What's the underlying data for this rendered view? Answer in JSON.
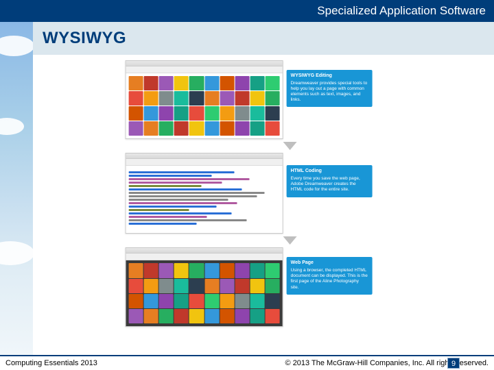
{
  "header": {
    "title": "Specialized Application Software"
  },
  "slide": {
    "title": "WYSIWYG"
  },
  "callouts": [
    {
      "title": "WYSIWYG Editing",
      "body": "Dreamweaver provides special tools to help you lay out a page with common elements such as text, images, and links."
    },
    {
      "title": "HTML Coding",
      "body": "Every time you save the web page, Adobe Dreamweaver creates the HTML code for the entire site."
    },
    {
      "title": "Web Page",
      "body": "Using a browser, the completed HTML document can be displayed. This is the first page of the Aline Photography site."
    }
  ],
  "thumbs": {
    "colors": [
      "#e67e22",
      "#c0392b",
      "#9b59b6",
      "#f1c40f",
      "#27ae60",
      "#3498db",
      "#d35400",
      "#8e44ad",
      "#16a085",
      "#2ecc71",
      "#e74c3c",
      "#f39c12",
      "#7f8c8d",
      "#1abc9c",
      "#2c3e50",
      "#e67e22",
      "#9b59b6",
      "#c0392b",
      "#f1c40f",
      "#27ae60",
      "#d35400",
      "#3498db",
      "#8e44ad",
      "#16a085",
      "#e74c3c",
      "#2ecc71",
      "#f39c12",
      "#7f8c8d",
      "#1abc9c",
      "#2c3e50",
      "#9b59b6",
      "#e67e22",
      "#27ae60",
      "#c0392b",
      "#f1c40f",
      "#3498db",
      "#d35400",
      "#8e44ad",
      "#16a085",
      "#e74c3c"
    ]
  },
  "footer": {
    "left": "Computing Essentials 2013",
    "right": "© 2013 The McGraw-Hill Companies, Inc. All rights reserved.",
    "page": "9"
  }
}
